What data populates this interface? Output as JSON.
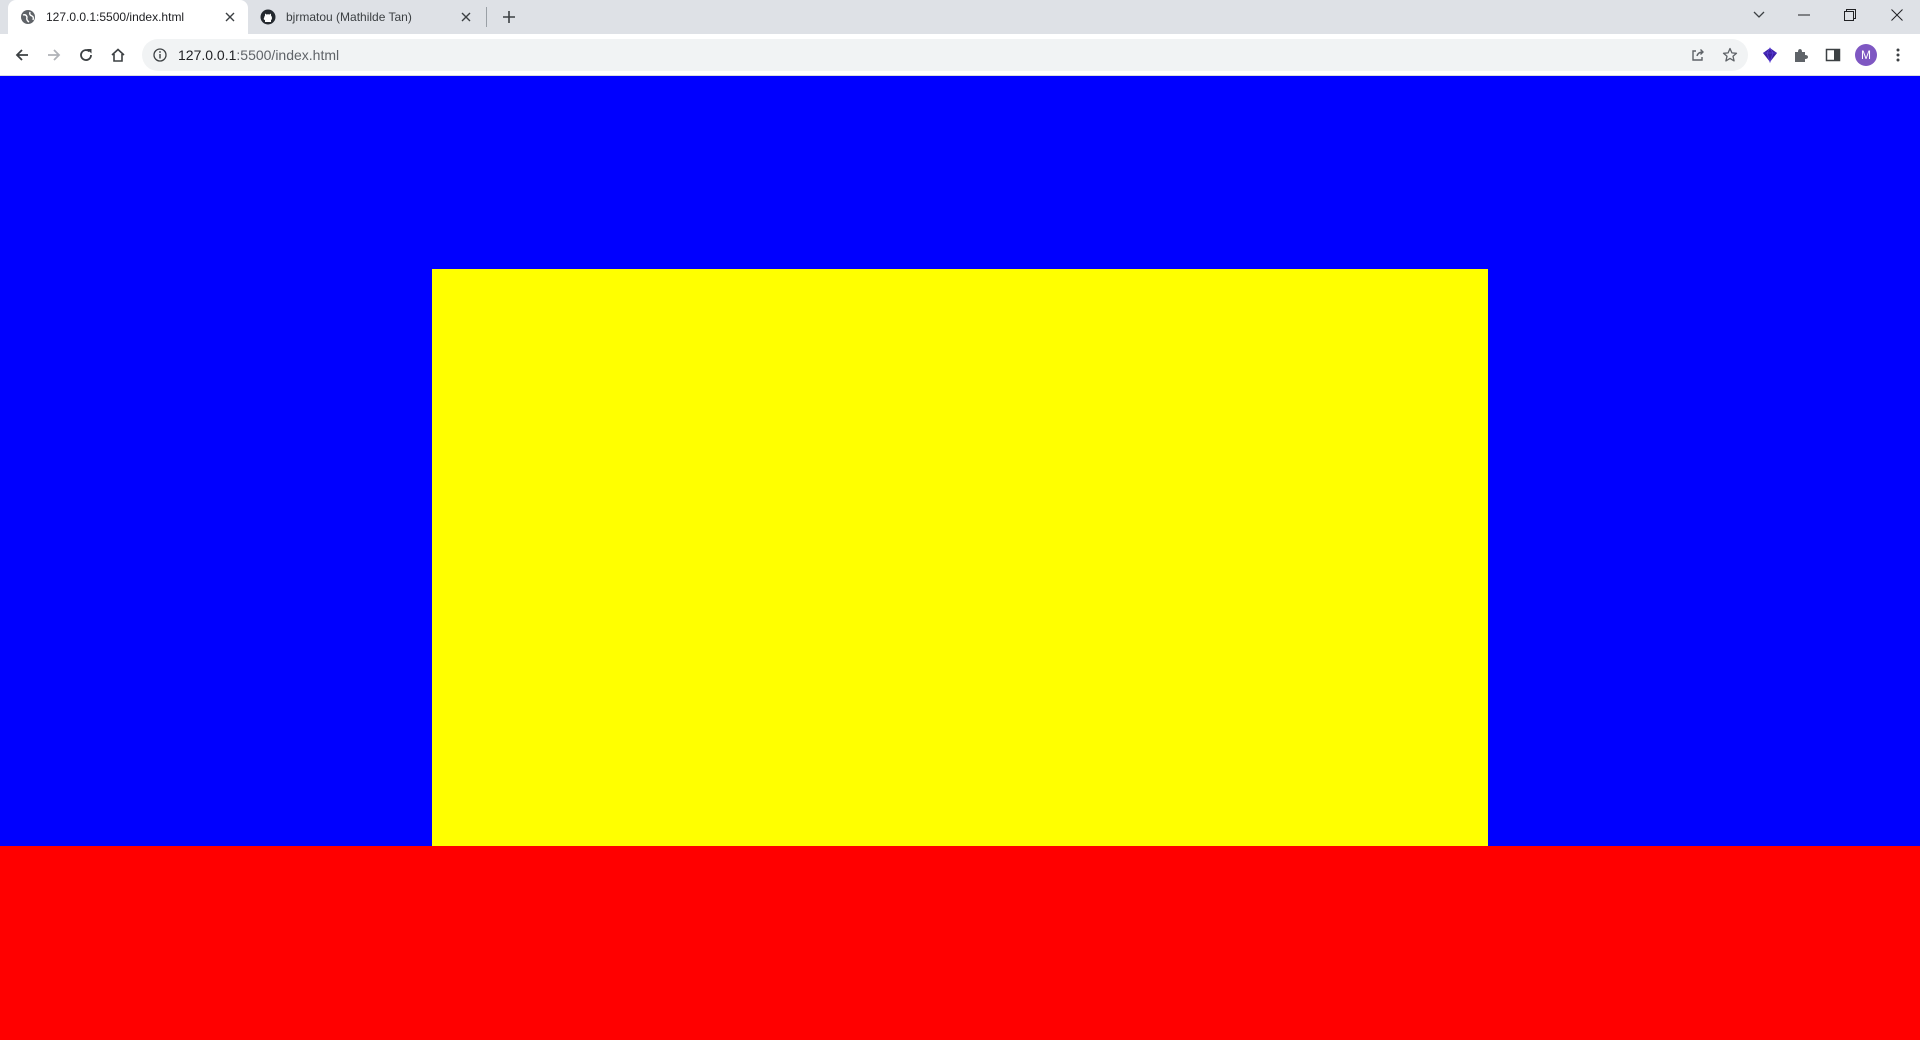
{
  "browser": {
    "tabs": [
      {
        "title": "127.0.0.1:5500/index.html",
        "favicon": "globe-icon",
        "active": true
      },
      {
        "title": "bjrmatou (Mathilde Tan)",
        "favicon": "github-icon",
        "active": false
      }
    ],
    "new_tab_icon": "plus-icon",
    "window_controls": [
      "tab-search-icon",
      "minimize-icon",
      "restore-icon",
      "close-icon"
    ],
    "address": {
      "host": "127.0.0.1",
      "path": ":5500/index.html"
    },
    "toolbar_icons": [
      "back-icon",
      "forward-icon",
      "reload-icon",
      "home-icon",
      "info-icon",
      "share-icon",
      "star-icon",
      "extension-gem-icon",
      "puzzle-icon",
      "side-panel-icon",
      "menu-icon"
    ],
    "profile": {
      "initial": "M",
      "color": "#7e57c2"
    }
  },
  "page": {
    "colors": {
      "top_band": "#0000ff",
      "center_box": "#ffff00",
      "bottom_band": "#ff0000"
    }
  }
}
